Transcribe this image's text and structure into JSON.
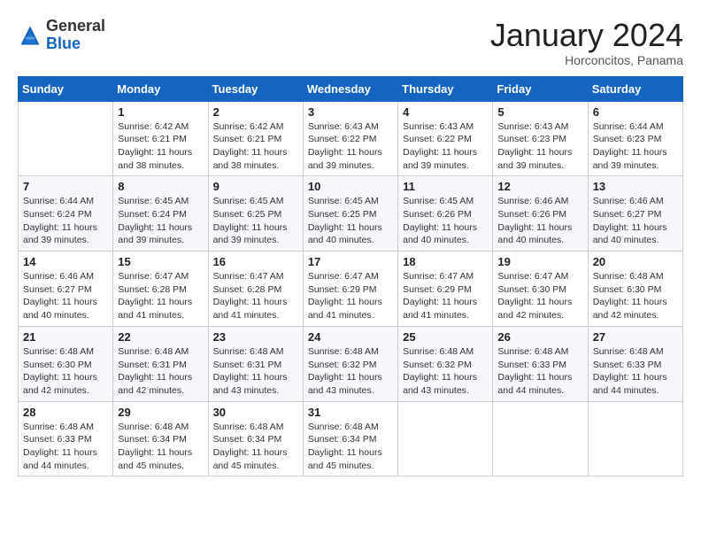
{
  "header": {
    "logo": {
      "general": "General",
      "blue": "Blue"
    },
    "title": "January 2024",
    "subtitle": "Horconcitos, Panama"
  },
  "weekdays": [
    "Sunday",
    "Monday",
    "Tuesday",
    "Wednesday",
    "Thursday",
    "Friday",
    "Saturday"
  ],
  "weeks": [
    [
      {
        "day": null
      },
      {
        "day": 1,
        "sunrise": "6:42 AM",
        "sunset": "6:21 PM",
        "daylight": "11 hours and 38 minutes."
      },
      {
        "day": 2,
        "sunrise": "6:42 AM",
        "sunset": "6:21 PM",
        "daylight": "11 hours and 38 minutes."
      },
      {
        "day": 3,
        "sunrise": "6:43 AM",
        "sunset": "6:22 PM",
        "daylight": "11 hours and 39 minutes."
      },
      {
        "day": 4,
        "sunrise": "6:43 AM",
        "sunset": "6:22 PM",
        "daylight": "11 hours and 39 minutes."
      },
      {
        "day": 5,
        "sunrise": "6:43 AM",
        "sunset": "6:23 PM",
        "daylight": "11 hours and 39 minutes."
      },
      {
        "day": 6,
        "sunrise": "6:44 AM",
        "sunset": "6:23 PM",
        "daylight": "11 hours and 39 minutes."
      }
    ],
    [
      {
        "day": 7,
        "sunrise": "6:44 AM",
        "sunset": "6:24 PM",
        "daylight": "11 hours and 39 minutes."
      },
      {
        "day": 8,
        "sunrise": "6:45 AM",
        "sunset": "6:24 PM",
        "daylight": "11 hours and 39 minutes."
      },
      {
        "day": 9,
        "sunrise": "6:45 AM",
        "sunset": "6:25 PM",
        "daylight": "11 hours and 39 minutes."
      },
      {
        "day": 10,
        "sunrise": "6:45 AM",
        "sunset": "6:25 PM",
        "daylight": "11 hours and 40 minutes."
      },
      {
        "day": 11,
        "sunrise": "6:45 AM",
        "sunset": "6:26 PM",
        "daylight": "11 hours and 40 minutes."
      },
      {
        "day": 12,
        "sunrise": "6:46 AM",
        "sunset": "6:26 PM",
        "daylight": "11 hours and 40 minutes."
      },
      {
        "day": 13,
        "sunrise": "6:46 AM",
        "sunset": "6:27 PM",
        "daylight": "11 hours and 40 minutes."
      }
    ],
    [
      {
        "day": 14,
        "sunrise": "6:46 AM",
        "sunset": "6:27 PM",
        "daylight": "11 hours and 40 minutes."
      },
      {
        "day": 15,
        "sunrise": "6:47 AM",
        "sunset": "6:28 PM",
        "daylight": "11 hours and 41 minutes."
      },
      {
        "day": 16,
        "sunrise": "6:47 AM",
        "sunset": "6:28 PM",
        "daylight": "11 hours and 41 minutes."
      },
      {
        "day": 17,
        "sunrise": "6:47 AM",
        "sunset": "6:29 PM",
        "daylight": "11 hours and 41 minutes."
      },
      {
        "day": 18,
        "sunrise": "6:47 AM",
        "sunset": "6:29 PM",
        "daylight": "11 hours and 41 minutes."
      },
      {
        "day": 19,
        "sunrise": "6:47 AM",
        "sunset": "6:30 PM",
        "daylight": "11 hours and 42 minutes."
      },
      {
        "day": 20,
        "sunrise": "6:48 AM",
        "sunset": "6:30 PM",
        "daylight": "11 hours and 42 minutes."
      }
    ],
    [
      {
        "day": 21,
        "sunrise": "6:48 AM",
        "sunset": "6:30 PM",
        "daylight": "11 hours and 42 minutes."
      },
      {
        "day": 22,
        "sunrise": "6:48 AM",
        "sunset": "6:31 PM",
        "daylight": "11 hours and 42 minutes."
      },
      {
        "day": 23,
        "sunrise": "6:48 AM",
        "sunset": "6:31 PM",
        "daylight": "11 hours and 43 minutes."
      },
      {
        "day": 24,
        "sunrise": "6:48 AM",
        "sunset": "6:32 PM",
        "daylight": "11 hours and 43 minutes."
      },
      {
        "day": 25,
        "sunrise": "6:48 AM",
        "sunset": "6:32 PM",
        "daylight": "11 hours and 43 minutes."
      },
      {
        "day": 26,
        "sunrise": "6:48 AM",
        "sunset": "6:33 PM",
        "daylight": "11 hours and 44 minutes."
      },
      {
        "day": 27,
        "sunrise": "6:48 AM",
        "sunset": "6:33 PM",
        "daylight": "11 hours and 44 minutes."
      }
    ],
    [
      {
        "day": 28,
        "sunrise": "6:48 AM",
        "sunset": "6:33 PM",
        "daylight": "11 hours and 44 minutes."
      },
      {
        "day": 29,
        "sunrise": "6:48 AM",
        "sunset": "6:34 PM",
        "daylight": "11 hours and 45 minutes."
      },
      {
        "day": 30,
        "sunrise": "6:48 AM",
        "sunset": "6:34 PM",
        "daylight": "11 hours and 45 minutes."
      },
      {
        "day": 31,
        "sunrise": "6:48 AM",
        "sunset": "6:34 PM",
        "daylight": "11 hours and 45 minutes."
      },
      {
        "day": null
      },
      {
        "day": null
      },
      {
        "day": null
      }
    ]
  ],
  "labels": {
    "sunrise": "Sunrise:",
    "sunset": "Sunset:",
    "daylight": "Daylight:"
  }
}
